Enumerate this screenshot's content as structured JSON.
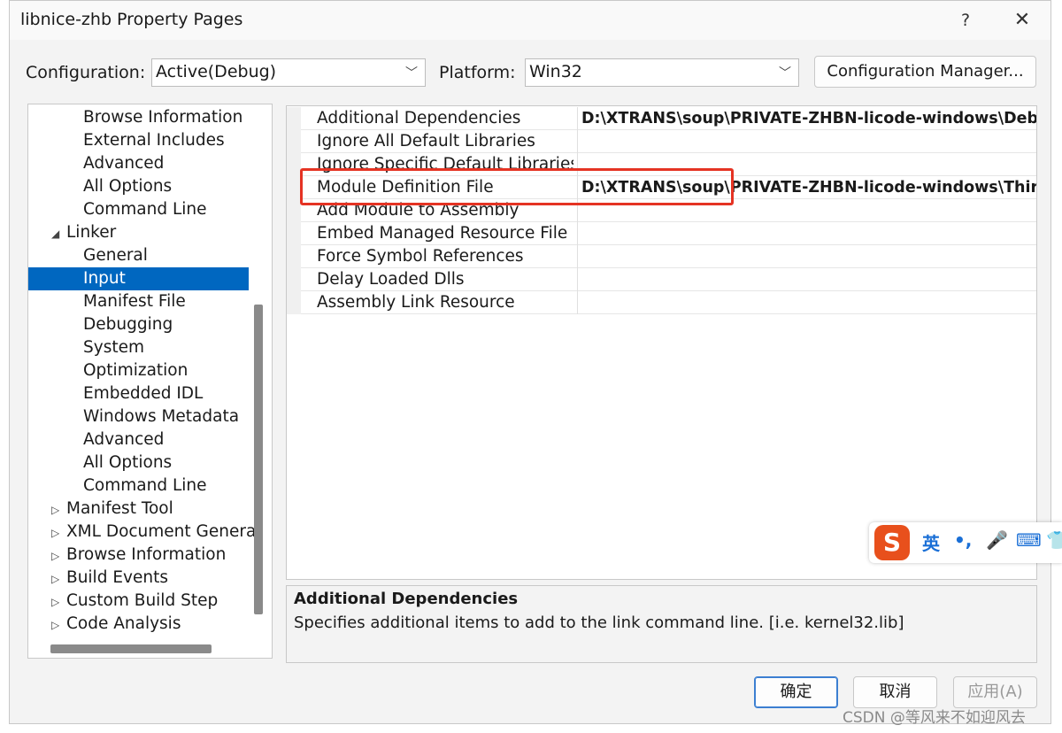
{
  "window": {
    "title": "libnice-zhb Property Pages",
    "help": "?",
    "close": "✕"
  },
  "toolbar": {
    "configuration_label": "Configuration:",
    "configuration_value": "Active(Debug)",
    "platform_label": "Platform:",
    "platform_value": "Win32",
    "manager_button": "Configuration Manager..."
  },
  "tree": {
    "items": [
      {
        "label": "Browse Information"
      },
      {
        "label": "External Includes"
      },
      {
        "label": "Advanced"
      },
      {
        "label": "All Options"
      },
      {
        "label": "Command Line"
      },
      {
        "label": "Linker",
        "twisty": "◢"
      },
      {
        "label": "General"
      },
      {
        "label": "Input",
        "selected": true
      },
      {
        "label": "Manifest File"
      },
      {
        "label": "Debugging"
      },
      {
        "label": "System"
      },
      {
        "label": "Optimization"
      },
      {
        "label": "Embedded IDL"
      },
      {
        "label": "Windows Metadata"
      },
      {
        "label": "Advanced"
      },
      {
        "label": "All Options"
      },
      {
        "label": "Command Line"
      },
      {
        "label": "Manifest Tool",
        "twisty": "▷"
      },
      {
        "label": "XML Document Generat",
        "twisty": "▷"
      },
      {
        "label": "Browse Information",
        "twisty": "▷"
      },
      {
        "label": "Build Events",
        "twisty": "▷"
      },
      {
        "label": "Custom Build Step",
        "twisty": "▷"
      },
      {
        "label": "Code Analysis",
        "twisty": "▷"
      }
    ]
  },
  "properties": [
    {
      "name": "Additional Dependencies",
      "value": "D:\\XTRANS\\soup\\PRIVATE-ZHBN-licode-windows\\Debug"
    },
    {
      "name": "Ignore All Default Libraries",
      "value": ""
    },
    {
      "name": "Ignore Specific Default Libraries",
      "value": ""
    },
    {
      "name": "Module Definition File",
      "value": "D:\\XTRANS\\soup\\PRIVATE-ZHBN-licode-windows\\ThirdP"
    },
    {
      "name": "Add Module to Assembly",
      "value": ""
    },
    {
      "name": "Embed Managed Resource File",
      "value": ""
    },
    {
      "name": "Force Symbol References",
      "value": ""
    },
    {
      "name": "Delay Loaded Dlls",
      "value": ""
    },
    {
      "name": "Assembly Link Resource",
      "value": ""
    }
  ],
  "description": {
    "title": "Additional Dependencies",
    "text": "Specifies additional items to add to the link command line. [i.e. kernel32.lib]"
  },
  "buttons": {
    "ok": "确定",
    "cancel": "取消",
    "apply": "应用(A)"
  },
  "ime": {
    "logo": "S",
    "lang": "英",
    "punct": "•,",
    "mic": "🎤",
    "keyboard": "⌨",
    "shirt": "👕"
  },
  "watermark": "CSDN @等风来不如迎风去",
  "colors": {
    "selection": "#0067c0",
    "highlight_box": "#e53323",
    "ime_brand": "#e8501c"
  }
}
